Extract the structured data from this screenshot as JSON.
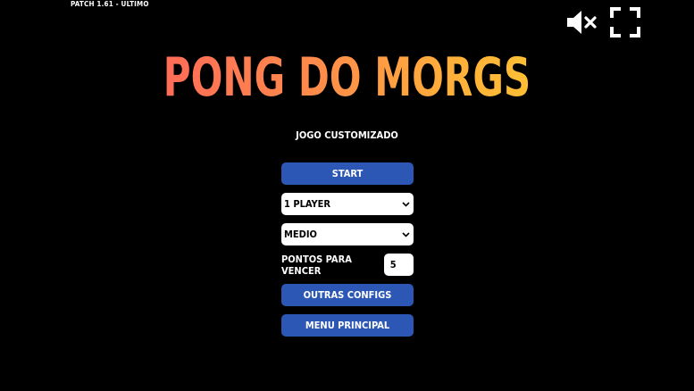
{
  "patch_text": "PATCH 1.61 - ULTIMO",
  "title": "PONG DO MORGS",
  "subtitle": "JOGO CUSTOMIZADO",
  "menu": {
    "start_label": "START",
    "players_value": "1 PLAYER",
    "difficulty_value": "MEDIO",
    "points_label": "PONTOS PARA VENCER",
    "points_value": "5",
    "other_configs_label": "OUTRAS CONFIGS",
    "main_menu_label": "MENU PRINCIPAL"
  },
  "icons": {
    "mute": "volume-muted-icon",
    "fullscreen": "fullscreen-icon",
    "select_arrow": "chevron-down-icon"
  },
  "colors": {
    "background": "#000000",
    "button": "#2c57b5",
    "title_gradient": [
      "#ff5a5f",
      "#ffb03a",
      "#ffd02e"
    ]
  }
}
